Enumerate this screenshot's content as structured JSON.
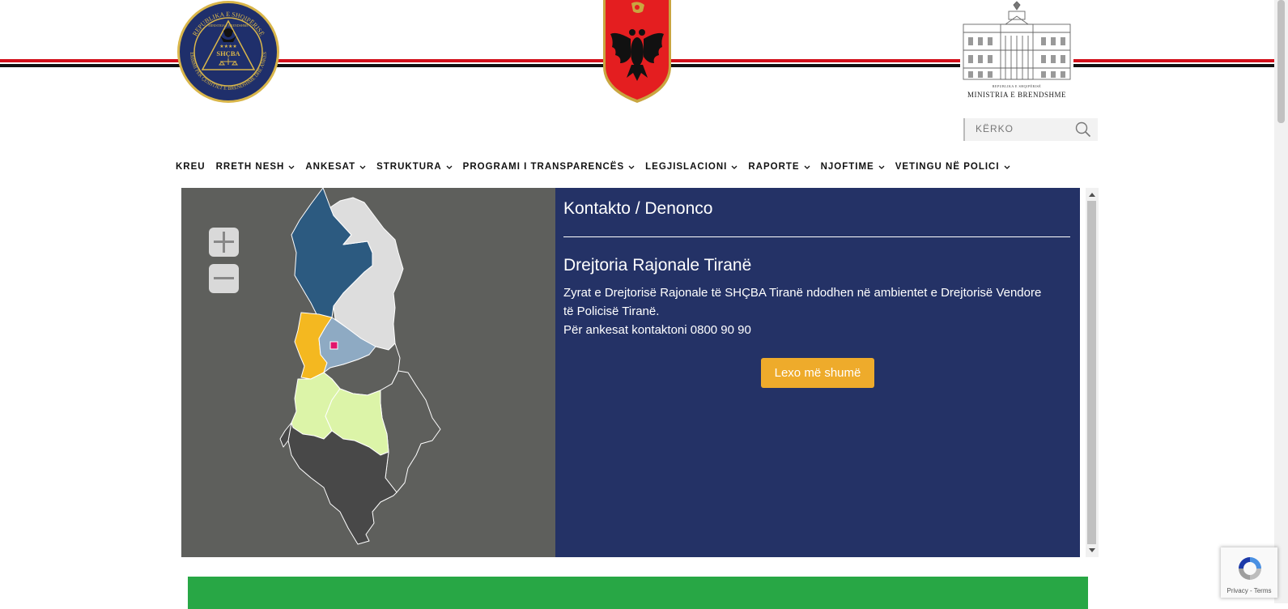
{
  "header": {
    "left_logo": {
      "arc_top": "REPUBLIKA E SHQIPËRISË",
      "inner_top": "MINISTRIA E BRENDSHME",
      "stars": "★★★★",
      "abbr": "SHÇBA",
      "arc_bottom": "SHËRBIMI PËR ÇËSHTJET E BRENDSHME DHE ANKESAT"
    },
    "right_logo": {
      "small_text": "REPUBLIKA E SHQIPËRISË",
      "ministry_name": "MINISTRIA E BRENDSHME"
    }
  },
  "search": {
    "placeholder": "KËRKO"
  },
  "nav": {
    "items": [
      {
        "label": "KREU",
        "dropdown": false
      },
      {
        "label": "RRETH NESH",
        "dropdown": true
      },
      {
        "label": "ANKESAT",
        "dropdown": true
      },
      {
        "label": "STRUKTURA",
        "dropdown": true
      },
      {
        "label": "PROGRAMI I TRANSPARENCËS",
        "dropdown": true
      },
      {
        "label": "LEGJISLACIONI",
        "dropdown": true
      },
      {
        "label": "RAPORTE",
        "dropdown": true
      },
      {
        "label": "NJOFTIME",
        "dropdown": true
      },
      {
        "label": "VETINGU NË POLICI",
        "dropdown": true
      }
    ]
  },
  "map": {
    "zoom_in_icon": "plus-icon",
    "zoom_out_icon": "minus-icon",
    "colors": {
      "background": "#5e5f5c",
      "north_region": "#2c5a80",
      "northeast_region": "#dddddd",
      "durres_region": "#f4b820",
      "tirana_region": "#8eaac3",
      "central_region": "#dcf4a8",
      "south_region": "#484848",
      "marker": "#e2156b"
    }
  },
  "info": {
    "title": "Kontakto / Denonco",
    "region_title": "Drejtoria Rajonale Tiranë",
    "description": "Zyrat e Drejtorisë Rajonale të SHÇBA Tiranë ndodhen në ambientet e Drejtorisë Vendore të Policisë Tiranë.",
    "contact": "Për ankesat kontaktoni 0800 90 90",
    "button_label": "Lexo më shumë",
    "colors": {
      "background": "#243266",
      "button": "#eeab2b"
    }
  },
  "footer_bar": {
    "color": "#28a745"
  },
  "recaptcha": {
    "terms_label": "Privacy - Terms"
  }
}
